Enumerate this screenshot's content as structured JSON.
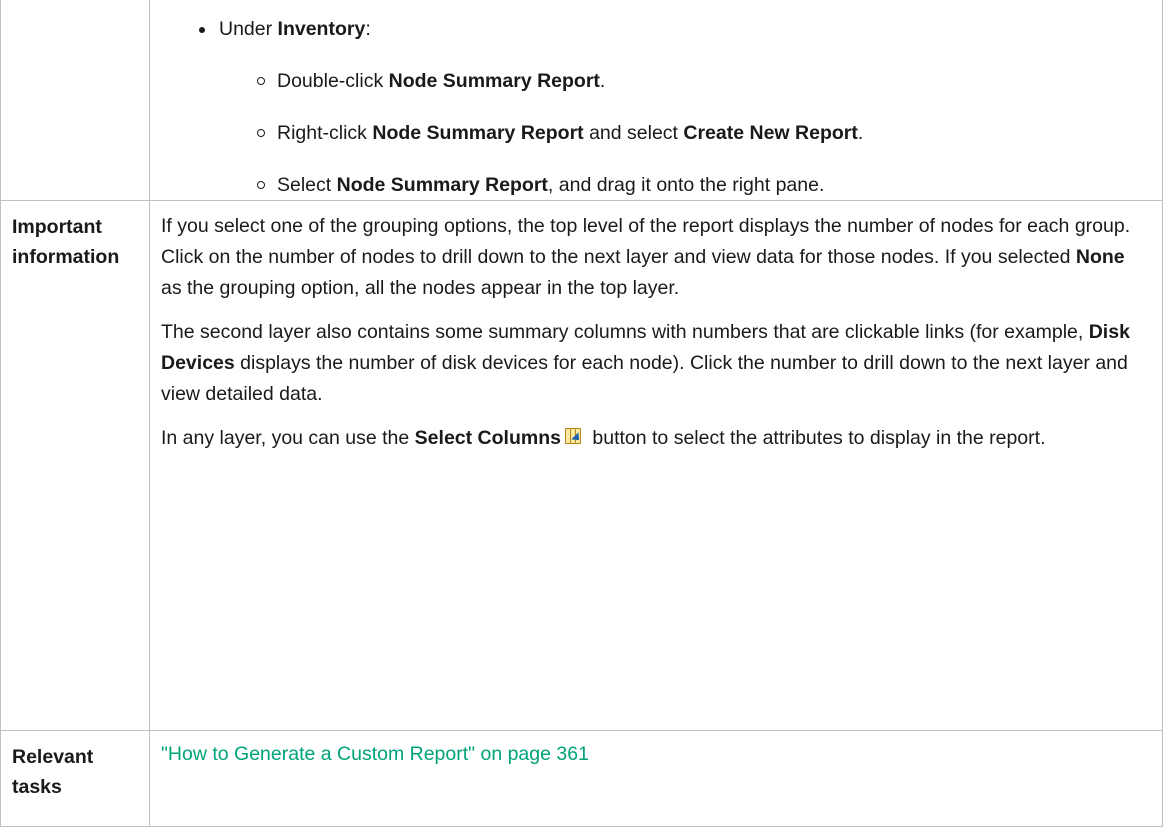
{
  "inventory_block": {
    "bullet": {
      "prefix": "Under ",
      "bold": "Inventory",
      "suffix": ":"
    },
    "sub_items": [
      {
        "t1": "Double-click ",
        "b1": "Node Summary Report",
        "t2": ".",
        "b2": "",
        "t3": ""
      },
      {
        "t1": "Right-click ",
        "b1": "Node Summary Report",
        "t2": " and select ",
        "b2": "Create New Report",
        "t3": "."
      },
      {
        "t1": "Select ",
        "b1": "Node Summary Report",
        "t2": ", and drag it onto the right pane.",
        "b2": "",
        "t3": ""
      }
    ]
  },
  "important": {
    "label": "Important information",
    "para1": {
      "t1": "If you select one of the grouping options, the top level of the report displays the number of nodes for each group. Click on the number of nodes to drill down to the next layer and view data for those nodes. If you selected ",
      "b1": "None",
      "t2": " as the grouping option, all the nodes appear in the top layer."
    },
    "para2": {
      "t1": "The second layer also contains some summary columns with numbers that are clickable links (for example, ",
      "b1": "Disk Devices",
      "t2": " displays the number of disk devices for each node). Click the number to drill down to the next layer and view detailed data."
    },
    "para3": {
      "t1": "In any layer, you can use the ",
      "b1": "Select Columns",
      "icon": "select-columns-icon",
      "t2": " button to select the attributes to display in the report."
    }
  },
  "relevant": {
    "label": "Relevant tasks",
    "link": "\"How to Generate a Custom Report\" on page 361"
  },
  "colors": {
    "link": "#00a37a",
    "border": "#bfbfbf",
    "text": "#1a1a1a"
  }
}
